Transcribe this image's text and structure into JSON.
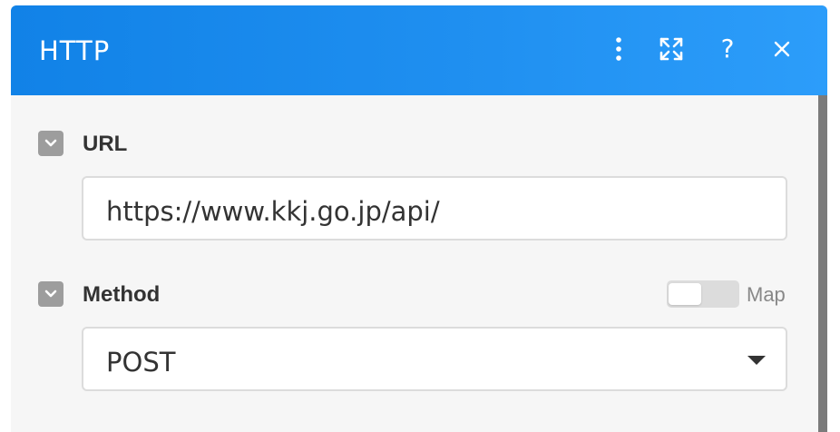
{
  "header": {
    "title": "HTTP",
    "icons": [
      "more-vertical-icon",
      "expand-icon",
      "help-icon",
      "close-icon"
    ],
    "help_glyph": "?",
    "gradient_start": "#1182e7",
    "gradient_end": "#2c9dfa"
  },
  "fields": {
    "url": {
      "label": "URL",
      "value": "https://www.kkj.go.jp/api/"
    },
    "method": {
      "label": "Method",
      "value": "POST",
      "map_toggle": {
        "label": "Map",
        "on": false
      }
    }
  }
}
